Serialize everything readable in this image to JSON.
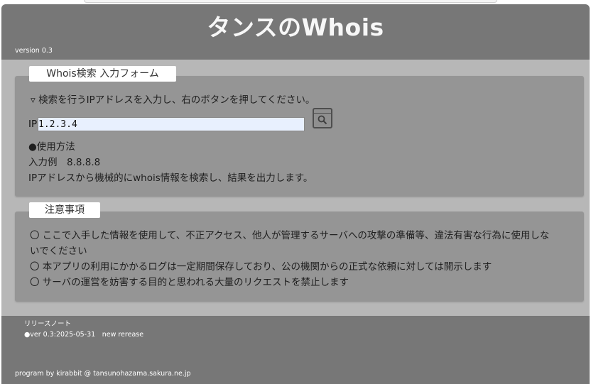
{
  "header": {
    "title": "タンスのWhois",
    "version": "version 0.3"
  },
  "form_panel": {
    "tab_label": "Whois検索 入力フォーム",
    "instruction": "▿ 検索を行うIPアドレスを入力し、右のボタンを押してください。",
    "ip_label": "IP",
    "ip_value": "1.2.3.4",
    "search_icon": "search-window-icon",
    "usage_heading": "●使用方法",
    "usage_example": "入力例　8.8.8.8",
    "usage_description": "IPアドレスから機械的にwhois情報を検索し、結果を出力します。"
  },
  "notice_panel": {
    "tab_label": "注意事項",
    "items": [
      "〇 ここで入手した情報を使用して、不正アクセス、他人が管理するサーバへの攻撃の準備等、違法有害な行為に使用しな",
      "いでください",
      "〇 本アプリの利用にかかるログは一定期間保存しており、公の機関からの正式な依頼に対しては開示します",
      "〇 サーバの運営を妨害する目的と思われる大量のリクエストを禁止します"
    ]
  },
  "footer": {
    "release_notes_title": "リリースノート",
    "release_entry": "●ver 0.3:2025-05-31　new rerease",
    "credit": "program by kirabbit @ tansunohazama.sakura.ne.jp"
  },
  "colors": {
    "header_bg": "#777777",
    "content_bg": "#b7b7b7",
    "panel_bg": "#959595",
    "input_bg": "#e8f0fe"
  }
}
